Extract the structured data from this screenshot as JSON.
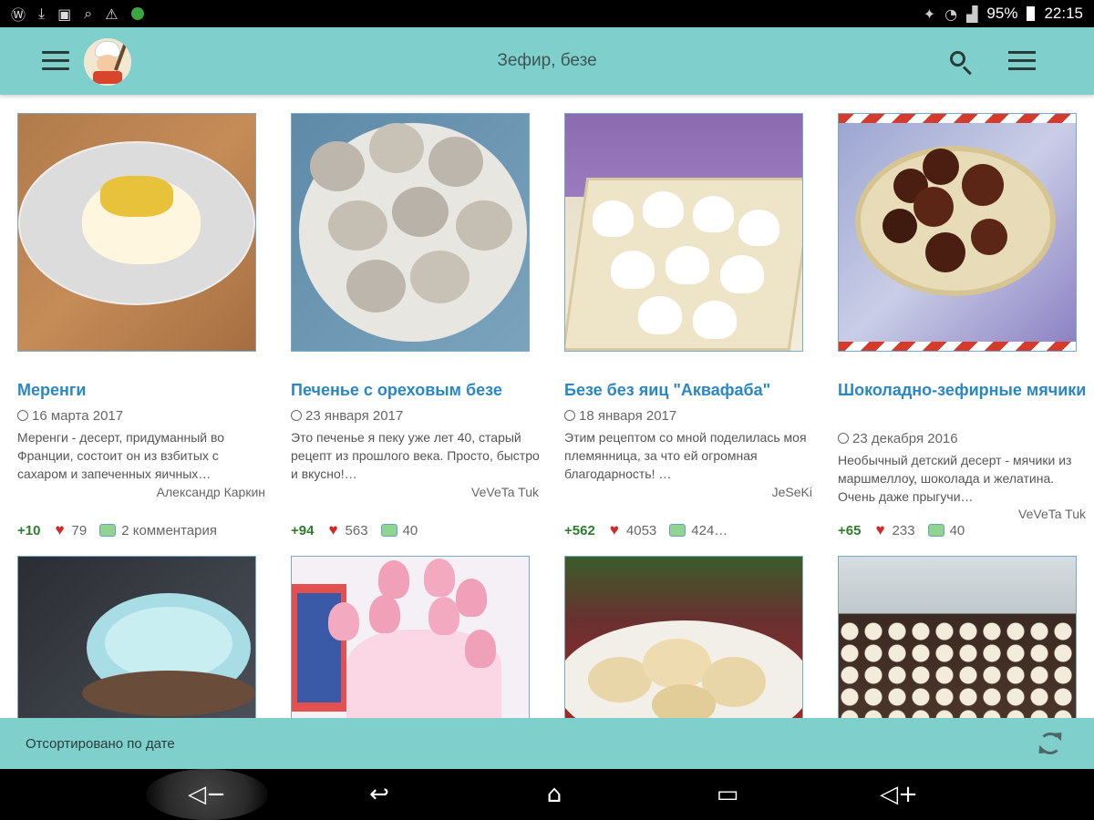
{
  "status": {
    "battery": "95%",
    "time": "22:15",
    "icons_left": [
      "wordpress-icon",
      "download-icon",
      "image-icon",
      "search-icon",
      "warning-icon",
      "shield-icon"
    ],
    "icons_right": [
      "bluetooth-icon",
      "wifi-icon",
      "signal-icon",
      "battery-icon"
    ]
  },
  "app_bar": {
    "title": "Зефир, безе"
  },
  "recipes": [
    {
      "title": "Меренги",
      "date": "16 марта 2017",
      "description": "Меренги - десерт, придуманный во Франции, состоит он из взбитых с сахаром и запеченных яичных…",
      "author": "Александр Каркин",
      "score": "+10",
      "likes": "79",
      "comments": "2 комментария"
    },
    {
      "title": "Печенье с ореховым безе",
      "date": "23 января 2017",
      "description": "Это печенье я пеку уже лет 40, старый рецепт из прошлого века. Просто, быстро и вкусно!…",
      "author": "VeVeTa Tuk",
      "score": "+94",
      "likes": "563",
      "comments": "40"
    },
    {
      "title": "Безе без яиц \"Аквафаба\"",
      "date": "18 января 2017",
      "description": "Этим рецептом со мной поделилась моя племянница, за что ей огромная благодарность! …",
      "author": "JeSeKi",
      "score": "+562",
      "likes": "4053",
      "comments": "424…"
    },
    {
      "title": "Шоколадно-зефирные мячики",
      "date": "23 декабря 2016",
      "description": "Необычный детский десерт - мячики из маршмеллоу, шоколада и желатина. Очень даже прыгучи…",
      "author": "VeVeTa Tuk",
      "score": "+65",
      "likes": "233",
      "comments": "40"
    }
  ],
  "bottom_bar": {
    "sort_label": "Отсортировано по дате"
  },
  "nav": {
    "volume_down": "◁−",
    "back": "↩",
    "home": "⌂",
    "recents": "▭",
    "volume_up": "◁+"
  }
}
